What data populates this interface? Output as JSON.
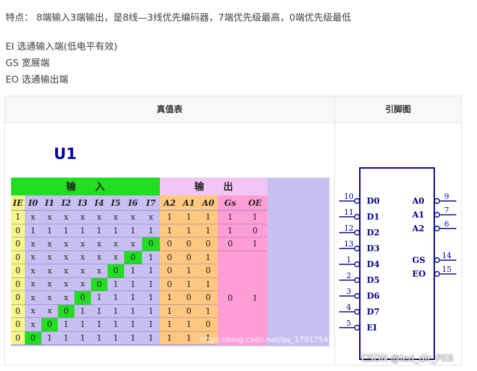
{
  "text": {
    "features": "特点： 8端输入3端输出，是8线—3线优先编码器，7端优先级最高，0端优先级最低",
    "ei": "EI 选通输入端(低电平有效)",
    "gs": "GS 宽展端",
    "eo": "EO 选通输出端"
  },
  "table": {
    "col1_header": "真值表",
    "col2_header": "引脚图"
  },
  "truth_table": {
    "group_input": "输　　入",
    "group_output": "输　　出",
    "headers": [
      "IE",
      "I0",
      "I1",
      "I2",
      "I3",
      "I4",
      "I5",
      "I6",
      "I7",
      "A2",
      "A1",
      "A0",
      "Gs",
      "OE"
    ],
    "rows": [
      [
        "1",
        "x",
        "x",
        "x",
        "x",
        "x",
        "x",
        "x",
        "x",
        "1",
        "1",
        "1",
        "1",
        "1"
      ],
      [
        "0",
        "1",
        "1",
        "1",
        "1",
        "1",
        "1",
        "1",
        "1",
        "1",
        "1",
        "1",
        "1",
        "0"
      ],
      [
        "0",
        "x",
        "x",
        "x",
        "x",
        "x",
        "x",
        "x",
        "0",
        "0",
        "0",
        "0",
        "0",
        "1"
      ],
      [
        "0",
        "x",
        "x",
        "x",
        "x",
        "x",
        "x",
        "0",
        "1",
        "0",
        "0",
        "1",
        "",
        ""
      ],
      [
        "0",
        "x",
        "x",
        "x",
        "x",
        "x",
        "0",
        "1",
        "1",
        "0",
        "1",
        "0",
        "",
        ""
      ],
      [
        "0",
        "x",
        "x",
        "x",
        "x",
        "0",
        "1",
        "1",
        "1",
        "0",
        "1",
        "1",
        "",
        ""
      ],
      [
        "0",
        "x",
        "x",
        "x",
        "0",
        "1",
        "1",
        "1",
        "1",
        "1",
        "0",
        "0",
        "",
        ""
      ],
      [
        "0",
        "x",
        "x",
        "0",
        "1",
        "1",
        "1",
        "1",
        "1",
        "1",
        "0",
        "1",
        "",
        ""
      ],
      [
        "0",
        "x",
        "0",
        "1",
        "1",
        "1",
        "1",
        "1",
        "1",
        "1",
        "1",
        "0",
        "",
        ""
      ],
      [
        "0",
        "0",
        "1",
        "1",
        "1",
        "1",
        "1",
        "1",
        "1",
        "1",
        "1",
        "1",
        "",
        ""
      ]
    ],
    "merged_gs": "0",
    "merged_oe": "1",
    "watermark": "https://blog.csdn.net/qq_17017545"
  },
  "pinout": {
    "title": "U1",
    "left_pins": [
      {
        "num": "10",
        "name": "D0"
      },
      {
        "num": "11",
        "name": "D1"
      },
      {
        "num": "12",
        "name": "D2"
      },
      {
        "num": "13",
        "name": "D3"
      },
      {
        "num": "1",
        "name": "D4"
      },
      {
        "num": "2",
        "name": "D5"
      },
      {
        "num": "3",
        "name": "D6"
      },
      {
        "num": "4",
        "name": "D7"
      },
      {
        "num": "5",
        "name": "EI"
      }
    ],
    "right_pins": [
      {
        "num": "9",
        "name": "A0"
      },
      {
        "num": "7",
        "name": "A1"
      },
      {
        "num": "6",
        "name": "A2"
      },
      {
        "num": "14",
        "name": "GS"
      },
      {
        "num": "15",
        "name": "EO"
      }
    ]
  },
  "credit": "CSDN @led_dir_PK6"
}
